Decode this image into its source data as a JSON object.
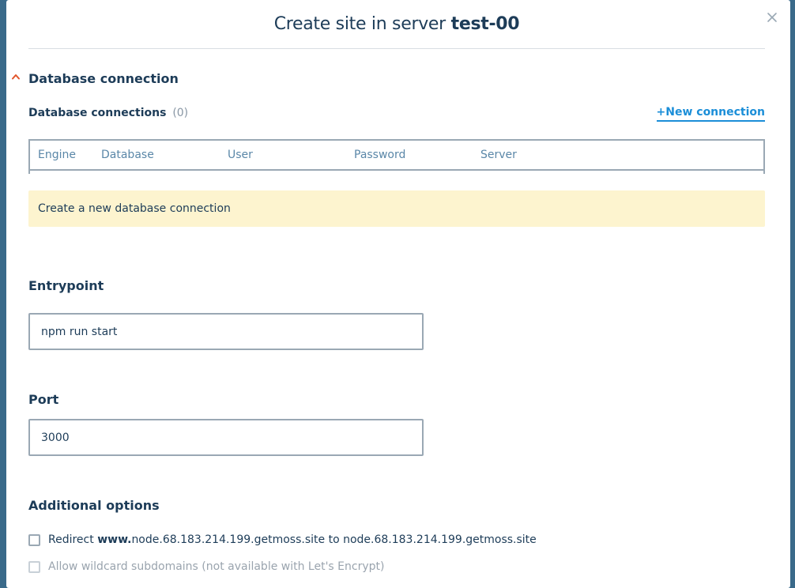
{
  "modal": {
    "title_prefix": "Create site in server",
    "title_server": "test-00"
  },
  "database": {
    "section_title": "Database connection",
    "connections_label": "Database connections",
    "connections_count": "(0)",
    "new_connection_label": "+New connection",
    "columns": [
      "Engine",
      "Database",
      "User",
      "Password",
      "Server"
    ],
    "notice": "Create a new database connection"
  },
  "entrypoint": {
    "label": "Entrypoint",
    "value": "npm run start"
  },
  "port": {
    "label": "Port",
    "value": "3000"
  },
  "options": {
    "title": "Additional options",
    "redirect": {
      "prefix": "Redirect",
      "www": "www.",
      "from_domain": "node.68.183.214.199.getmoss.site",
      "to_word": "to",
      "to_domain": "node.68.183.214.199.getmoss.site"
    },
    "wildcard_label": "Allow wildcard subdomains (not available with Let's Encrypt)"
  },
  "icons": {
    "close": "close-icon",
    "chevron": "chevron-up-icon"
  },
  "colors": {
    "accent": "#1b8ed8",
    "chevron": "#e2552b",
    "notice_bg": "#fdf4cf",
    "text": "#1d3c58"
  }
}
